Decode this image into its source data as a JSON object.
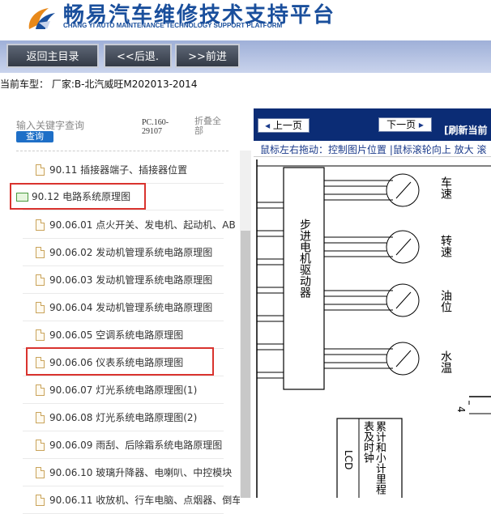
{
  "header": {
    "title_cn": "畅易汽车维修技术支持平台",
    "title_en": "CHANG YI AUTO MAINTENANCE TECHNOLOGY SUPPORT PLATFORM"
  },
  "nav": {
    "home": "返回主目录",
    "back": "<<后退.",
    "forward": ">>前进"
  },
  "vehicle": "当前车型：  厂家:B-北汽威旺M202013-2014",
  "sidebar": {
    "search_placeholder": "输入关键字查询",
    "search_button": "查询",
    "code": "PC.160-29107",
    "fold_all": "折叠全部",
    "items": [
      {
        "label": "90.11 插接器端子、插接器位置",
        "type": "file"
      },
      {
        "label": "90.12 电路系统原理图",
        "type": "folder"
      },
      {
        "label": "90.06.01 点火开关、发电机、起动机、AB",
        "type": "file"
      },
      {
        "label": "90.06.02 发动机管理系统电路原理图",
        "type": "file"
      },
      {
        "label": "90.06.03 发动机管理系统电路原理图",
        "type": "file"
      },
      {
        "label": "90.06.04 发动机管理系统电路原理图",
        "type": "file"
      },
      {
        "label": "90.06.05 空调系统电路原理图",
        "type": "file"
      },
      {
        "label": "90.06.06 仪表系统电路原理图",
        "type": "file"
      },
      {
        "label": "90.06.07 灯光系统电路原理图(1)",
        "type": "file"
      },
      {
        "label": "90.06.08 灯光系统电路原理图(2)",
        "type": "file"
      },
      {
        "label": "90.06.09 雨刮、后除霜系统电路原理图",
        "type": "file"
      },
      {
        "label": "90.06.10 玻璃升降器、电喇叭、中控模块",
        "type": "file"
      },
      {
        "label": "90.06.11 收放机、行车电脑、点烟器、倒车",
        "type": "file"
      }
    ]
  },
  "viewer": {
    "prev": "上一页",
    "next": "下一页",
    "refresh": "[刷新当前",
    "hint": "鼠标左右拖动：控制图片位置 |鼠标滚轮向上 放大  滚",
    "gauges": [
      "车速",
      "转速",
      "油位",
      "水温"
    ],
    "driver_label": "步进电机驱动器",
    "odometer_label": "累计和小计里程表及时钟",
    "lcd_label": "LCD",
    "pin_label": "4"
  },
  "colors": {
    "brand": "#1a4f9c",
    "nav_bg": "#9fb0d8",
    "viewer_bar": "#0b2c75",
    "highlight": "#d9332e",
    "search_button": "#1e6fc7"
  }
}
